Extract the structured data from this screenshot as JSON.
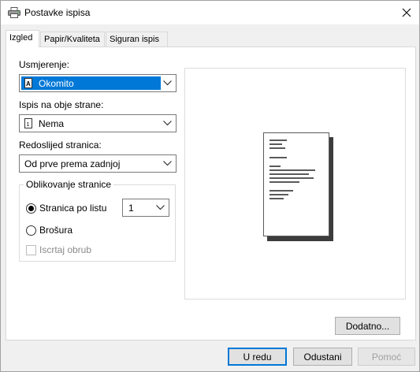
{
  "window": {
    "title": "Postavke ispisa",
    "icon": "printer-icon",
    "close_icon": "close-icon"
  },
  "tabs": [
    {
      "label": "Izgled",
      "active": true
    },
    {
      "label": "Papir/Kvaliteta",
      "active": false
    },
    {
      "label": "Siguran ispis",
      "active": false
    }
  ],
  "layout_tab": {
    "orientation": {
      "label": "Usmjerenje:",
      "value": "Okomito",
      "icon": "portrait-page-icon"
    },
    "duplex": {
      "label": "Ispis na obje strane:",
      "value": "Nema",
      "icon": "single-side-page-icon"
    },
    "page_order": {
      "label": "Redoslijed stranica:",
      "value": "Od prve prema zadnjoj"
    },
    "page_format": {
      "group_label": "Oblikovanje stranice",
      "pages_per_sheet": {
        "label": "Stranica po listu",
        "selected": true,
        "value": "1"
      },
      "booklet": {
        "label": "Brošura",
        "selected": false
      },
      "draw_borders": {
        "label": "Iscrtaj obrub",
        "checked": false,
        "enabled": false
      }
    },
    "advanced_button": "Dodatno..."
  },
  "buttons": {
    "ok": "U redu",
    "cancel": "Odustani",
    "help": "Pomoć"
  },
  "colors": {
    "accent": "#0078d7",
    "panel": "#ffffff",
    "dialog_bg": "#f0f0f0"
  }
}
